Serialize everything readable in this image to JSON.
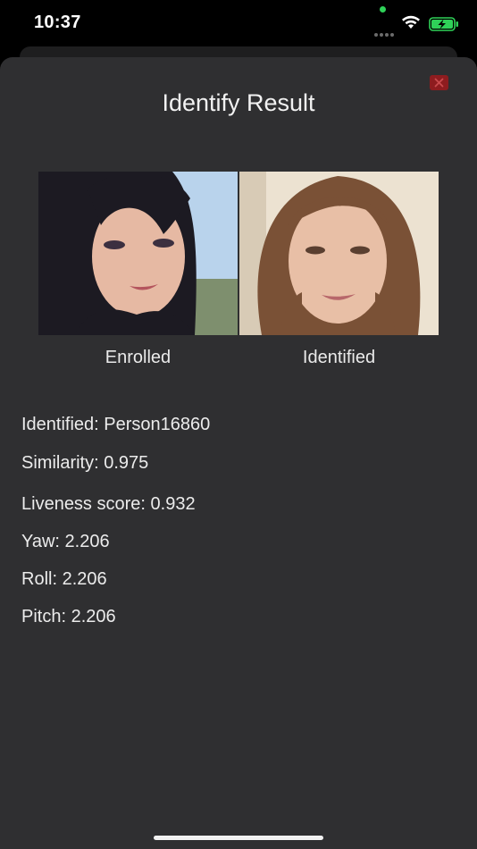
{
  "status_bar": {
    "time": "10:37"
  },
  "title": "Identify Result",
  "photos": {
    "enrolled_caption": "Enrolled",
    "identified_caption": "Identified"
  },
  "results": {
    "identified": "Identified: Person16860",
    "similarity": "Similarity: 0.975",
    "liveness": "Liveness score: 0.932",
    "yaw": "Yaw: 2.206",
    "roll": "Roll: 2.206",
    "pitch": "Pitch: 2.206"
  },
  "colors": {
    "sheet_background": "#2f2f31",
    "close_button": "#8e1c1f",
    "battery_charging": "#2fd158"
  },
  "icons": {
    "close": "close-icon",
    "wifi": "wifi-icon",
    "battery": "battery-charging-icon"
  }
}
